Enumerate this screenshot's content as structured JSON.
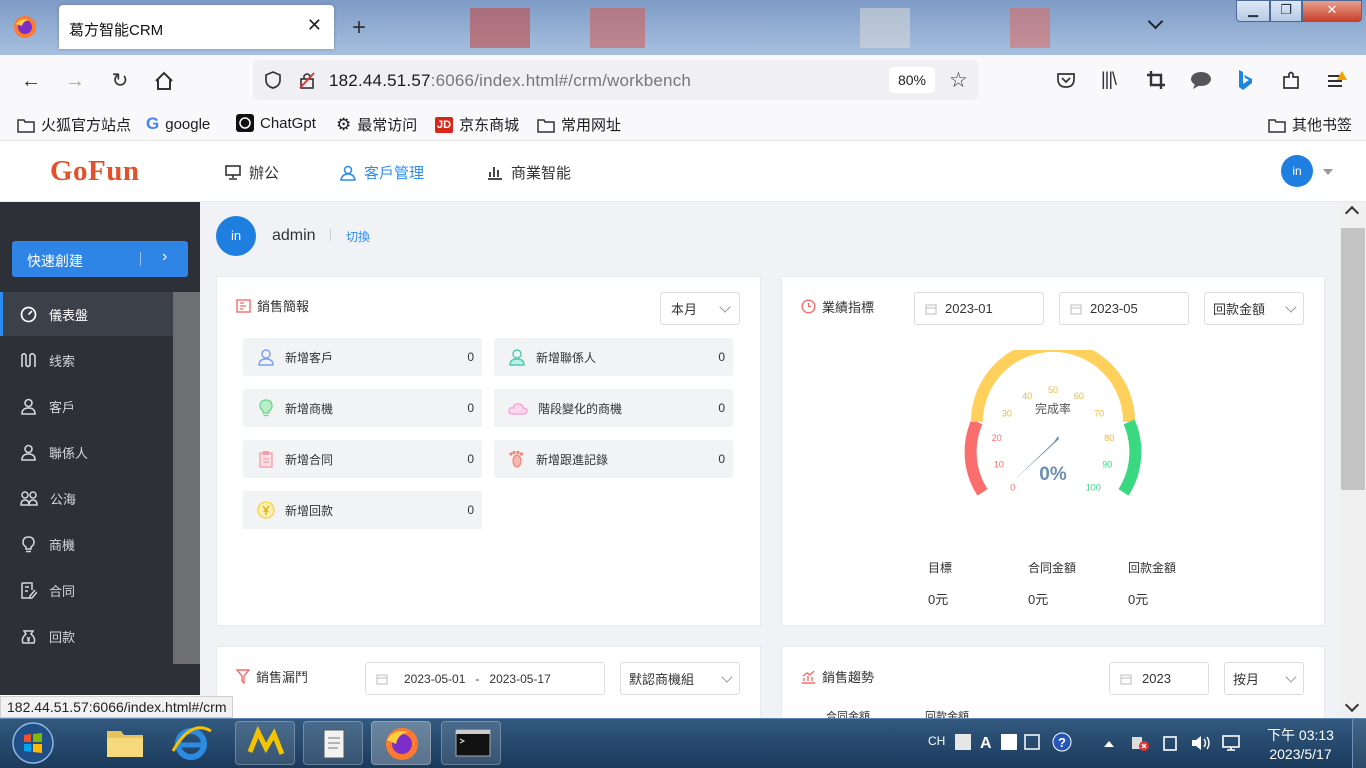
{
  "browser": {
    "tab_title": "葛方智能CRM",
    "url_host": "182.44.51.57",
    "url_rest": ":6066/index.html#/crm/workbench",
    "zoom": "80%",
    "bookmarks": [
      "火狐官方站点",
      "google",
      "ChatGpt",
      "最常访问",
      "京东商城",
      "常用网址"
    ],
    "other_bookmarks": "其他书签",
    "status_url": "182.44.51.57:6066/index.html#/crm"
  },
  "app": {
    "logo": "GoFun",
    "nav": [
      "辦公",
      "客戶管理",
      "商業智能"
    ],
    "active_nav": "客戶管理",
    "avatar_text": "in"
  },
  "sidebar": {
    "quick_create": "快速創建",
    "items": [
      {
        "label": "儀表盤",
        "icon": "dashboard-icon",
        "active": true
      },
      {
        "label": "线索",
        "icon": "clue-icon"
      },
      {
        "label": "客戶",
        "icon": "customer-icon"
      },
      {
        "label": "聯係人",
        "icon": "contact-icon"
      },
      {
        "label": "公海",
        "icon": "pool-icon"
      },
      {
        "label": "商機",
        "icon": "bulb-icon"
      },
      {
        "label": "合同",
        "icon": "contract-icon"
      },
      {
        "label": "回款",
        "icon": "payment-icon"
      }
    ]
  },
  "user": {
    "name": "admin",
    "switch_label": "切換",
    "avatar_text": "in"
  },
  "sales_brief": {
    "title": "銷售簡報",
    "period": "本月",
    "stats": [
      {
        "label": "新增客戶",
        "value": "0",
        "icon": "customer-icon",
        "color": "#7b9ff2"
      },
      {
        "label": "新增聯係人",
        "value": "0",
        "icon": "contact-icon",
        "color": "#4ecbb4"
      },
      {
        "label": "新增商機",
        "value": "0",
        "icon": "bulb-icon",
        "color": "#6fd38c"
      },
      {
        "label": "階段變化的商機",
        "value": "0",
        "icon": "cloud-icon",
        "color": "#f29fd4"
      },
      {
        "label": "新增合同",
        "value": "0",
        "icon": "contract-icon",
        "color": "#f59ca7"
      },
      {
        "label": "新增跟進記錄",
        "value": "0",
        "icon": "footprint-icon",
        "color": "#f3857b"
      },
      {
        "label": "新增回款",
        "value": "0",
        "icon": "yen-icon",
        "color": "#f8d33b"
      }
    ]
  },
  "performance": {
    "title": "業績指標",
    "start": "2023-01",
    "end": "2023-05",
    "metric": "回款金額",
    "gauge_title": "完成率",
    "gauge_value": "0%",
    "gauge_ticks": [
      "0",
      "10",
      "20",
      "30",
      "40",
      "50",
      "60",
      "70",
      "80",
      "90",
      "100"
    ],
    "summary": [
      {
        "label": "目標",
        "value": "0元"
      },
      {
        "label": "合同金額",
        "value": "0元"
      },
      {
        "label": "回款金額",
        "value": "0元"
      }
    ]
  },
  "funnel": {
    "title": "銷售漏鬥",
    "start": "2023-05-01",
    "sep": "-",
    "end": "2023-05-17",
    "group": "默認商機組"
  },
  "trend": {
    "title": "銷售趨勢",
    "year": "2023",
    "mode": "按月",
    "legend": [
      "合同金額",
      "回款金額"
    ]
  },
  "taskbar": {
    "lang": "CH",
    "time": "下午 03:13",
    "date": "2023/5/17"
  },
  "colors": {
    "primary": "#2d8cf0",
    "sidebar": "#2d3037",
    "logo": "#e3512b",
    "gauge_red": "#fb6e6e",
    "gauge_yellow": "#ffd05b",
    "gauge_green": "#3ad880"
  }
}
